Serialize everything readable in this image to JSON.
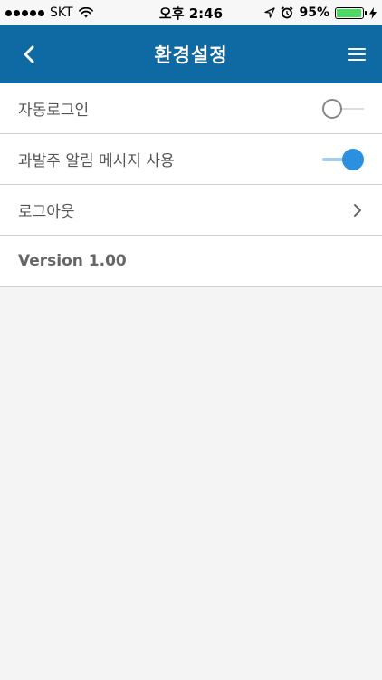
{
  "status_bar": {
    "carrier": "SKT",
    "time": "오후 2:46",
    "battery": "95%",
    "battery_level": 0.95,
    "icons": [
      "signal-dots-icon",
      "wifi-icon",
      "location-icon",
      "alarm-icon",
      "battery-icon",
      "charging-icon"
    ]
  },
  "header": {
    "title": "환경설정",
    "back_icon": "chevron-left-icon",
    "menu_icon": "hamburger-menu-icon",
    "background": "#0f6aa3"
  },
  "settings": {
    "auto_login": {
      "label": "자동로그인",
      "enabled": false
    },
    "penalty_alert": {
      "label": "과발주 알림 메시지 사용",
      "enabled": true,
      "accent": "#2d8fe0"
    },
    "logout": {
      "label": "로그아웃"
    },
    "version": {
      "label": "Version 1.00"
    }
  }
}
